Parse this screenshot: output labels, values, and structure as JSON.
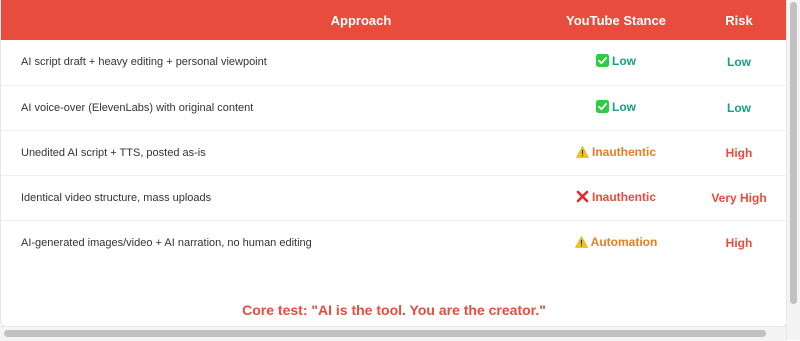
{
  "table": {
    "headers": {
      "approach": "Approach",
      "stance": "YouTube Stance",
      "risk": "Risk"
    },
    "rows": [
      {
        "approach": "AI script draft + heavy editing + personal viewpoint",
        "stance_icon": "check-icon",
        "stance": "Low",
        "risk": "Low"
      },
      {
        "approach": "AI voice-over (ElevenLabs) with original content",
        "stance_icon": "check-icon",
        "stance": "Low",
        "risk": "Low"
      },
      {
        "approach": "Unedited AI script + TTS, posted as-is",
        "stance_icon": "warning-icon",
        "stance": "Inauthentic",
        "risk": "High"
      },
      {
        "approach": "Identical video structure, mass uploads",
        "stance_icon": "cross-icon",
        "stance": "Inauthentic",
        "risk": "Very High"
      },
      {
        "approach": "AI-generated images/video + AI narration, no human editing",
        "stance_icon": "warning-icon",
        "stance": "Automation",
        "risk": "High"
      }
    ]
  },
  "core_test": "Core test: \"AI is the tool. You are the creator.\"",
  "colors": {
    "header_bg": "#e74c3c",
    "low": "#16a085",
    "warning": "#e67e22",
    "high": "#e74c3c"
  }
}
